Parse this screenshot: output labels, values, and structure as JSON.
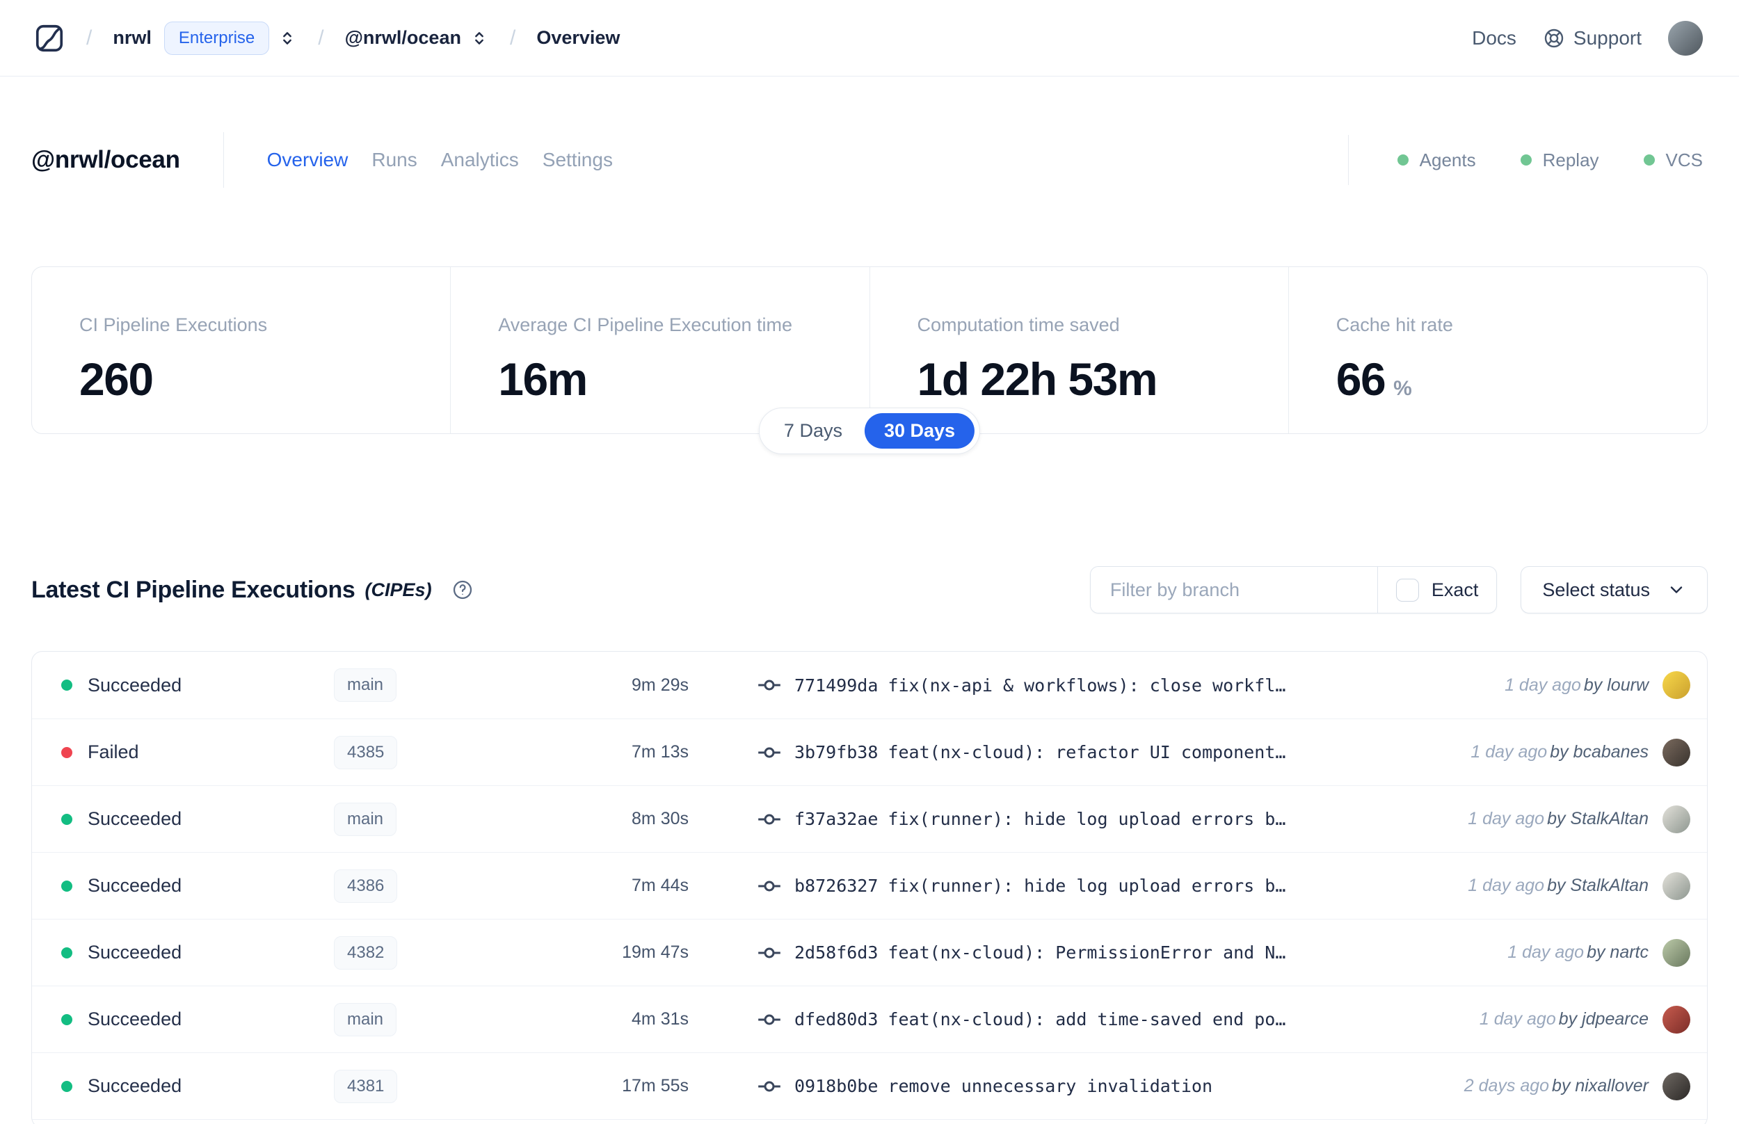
{
  "colors": {
    "accent": "#2563eb",
    "succeeded": "#13bd82",
    "failed": "#ef4450",
    "indicator_green": "#71c693"
  },
  "nav": {
    "separator": "/",
    "org": "nrwl",
    "org_badge": "Enterprise",
    "workspace": "@nrwl/ocean",
    "page": "Overview",
    "docs_label": "Docs",
    "support_label": "Support",
    "avatar_gradient": {
      "from": "#9aa5ad",
      "to": "#4f575e"
    }
  },
  "workspace": {
    "title": "@nrwl/ocean",
    "tabs": [
      {
        "label": "Overview",
        "active": true
      },
      {
        "label": "Runs",
        "active": false
      },
      {
        "label": "Analytics",
        "active": false
      },
      {
        "label": "Settings",
        "active": false
      }
    ],
    "indicators": [
      {
        "label": "Agents"
      },
      {
        "label": "Replay"
      },
      {
        "label": "VCS"
      }
    ]
  },
  "stats": {
    "cards": [
      {
        "label": "CI Pipeline Executions",
        "value": "260",
        "unit": ""
      },
      {
        "label": "Average CI Pipeline Execution time",
        "value": "16m",
        "unit": ""
      },
      {
        "label": "Computation time saved",
        "value": "1d 22h 53m",
        "unit": ""
      },
      {
        "label": "Cache hit rate",
        "value": "66",
        "unit": "%"
      }
    ],
    "range_toggle": {
      "options": [
        "7 Days",
        "30 Days"
      ],
      "selected": "30 Days"
    }
  },
  "list": {
    "title": "Latest CI Pipeline Executions",
    "title_suffix": "(CIPEs)",
    "filter_placeholder": "Filter by branch",
    "exact_label": "Exact",
    "status_select_label": "Select status"
  },
  "table": {
    "rows": [
      {
        "status": "Succeeded",
        "branch": "main",
        "duration": "9m 29s",
        "commit_hash": "771499da",
        "commit_message": "fix(nx-api & workflows): close workfl…",
        "time_ago": "1 day ago",
        "author": "by lourw",
        "avatar_gradient": {
          "from": "#f8d84a",
          "to": "#caa02e"
        }
      },
      {
        "status": "Failed",
        "branch": "4385",
        "duration": "7m 13s",
        "commit_hash": "3b79fb38",
        "commit_message": "feat(nx-cloud): refactor UI component…",
        "time_ago": "1 day ago",
        "author": "by bcabanes",
        "avatar_gradient": {
          "from": "#7a6a5e",
          "to": "#39332e"
        }
      },
      {
        "status": "Succeeded",
        "branch": "main",
        "duration": "8m 30s",
        "commit_hash": "f37a32ae",
        "commit_message": "fix(runner): hide log upload errors b…",
        "time_ago": "1 day ago",
        "author": "by StalkAltan",
        "avatar_gradient": {
          "from": "#e3e1da",
          "to": "#8e9790"
        }
      },
      {
        "status": "Succeeded",
        "branch": "4386",
        "duration": "7m 44s",
        "commit_hash": "b8726327",
        "commit_message": "fix(runner): hide log upload errors b…",
        "time_ago": "1 day ago",
        "author": "by StalkAltan",
        "avatar_gradient": {
          "from": "#e3e1da",
          "to": "#8e9790"
        }
      },
      {
        "status": "Succeeded",
        "branch": "4382",
        "duration": "19m 47s",
        "commit_hash": "2d58f6d3",
        "commit_message": "feat(nx-cloud): PermissionError and N…",
        "time_ago": "1 day ago",
        "author": "by nartc",
        "avatar_gradient": {
          "from": "#bccaa9",
          "to": "#69785e"
        }
      },
      {
        "status": "Succeeded",
        "branch": "main",
        "duration": "4m 31s",
        "commit_hash": "dfed80d3",
        "commit_message": "feat(nx-cloud): add time-saved end po…",
        "time_ago": "1 day ago",
        "author": "by jdpearce",
        "avatar_gradient": {
          "from": "#c75b4e",
          "to": "#7c2d28"
        }
      },
      {
        "status": "Succeeded",
        "branch": "4381",
        "duration": "17m 55s",
        "commit_hash": "0918b0be",
        "commit_message": "remove unnecessary invalidation",
        "time_ago": "2 days ago",
        "author": "by nixallover",
        "avatar_gradient": {
          "from": "#6e6862",
          "to": "#2c2927"
        }
      }
    ]
  }
}
